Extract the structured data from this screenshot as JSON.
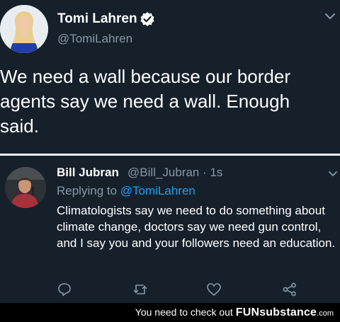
{
  "main_tweet": {
    "author_name": "Tomi Lahren",
    "author_handle": "@TomiLahren",
    "text": "We need a wall because our border agents say we need a wall. Enough said."
  },
  "reply": {
    "author_name": "Bill Jubran",
    "author_handle": "@Bill_Jubran · 1s",
    "replying_prefix": "Replying to",
    "replying_handle": "@TomiLahren",
    "text": "Climatologists say we need to do something about climate change, doctors say we need gun control, and I say you and your followers need an education."
  },
  "footer": {
    "prefix": "You need to check out",
    "brand": "FUNsubstance",
    "suffix": ".com"
  },
  "icons": [
    "verified-icon",
    "chevron-down-icon",
    "reply-icon",
    "retweet-icon",
    "like-icon",
    "share-icon"
  ],
  "colors": {
    "background": "#15202b",
    "secondary_text": "#8899a6",
    "link": "#1da1f2",
    "footer_bg": "#000000"
  }
}
